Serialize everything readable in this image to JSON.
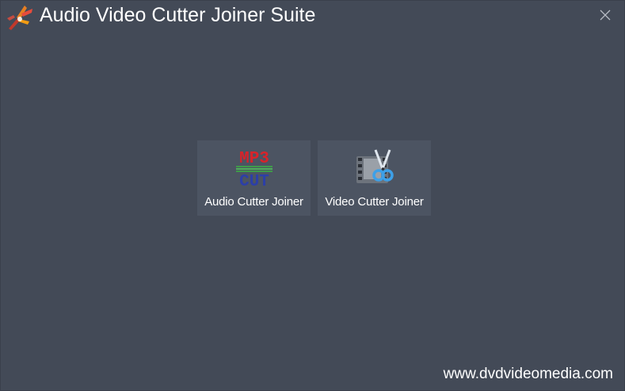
{
  "window": {
    "title": "Audio Video Cutter Joiner Suite",
    "close_icon": "close-icon",
    "app_icon": "app-logo-icon"
  },
  "tiles": [
    {
      "label": "Audio Cutter Joiner",
      "icon": "mp3-cut-icon"
    },
    {
      "label": "Video Cutter Joiner",
      "icon": "film-scissors-icon"
    }
  ],
  "footer": {
    "website": "www.dvdvideomedia.com"
  },
  "colors": {
    "background": "#434a57",
    "tile": "#4c5462",
    "text": "#ffffff",
    "mp3_red": "#d8232a",
    "cut_blue": "#2c3fa8",
    "scissors_blue": "#3da0e8"
  }
}
